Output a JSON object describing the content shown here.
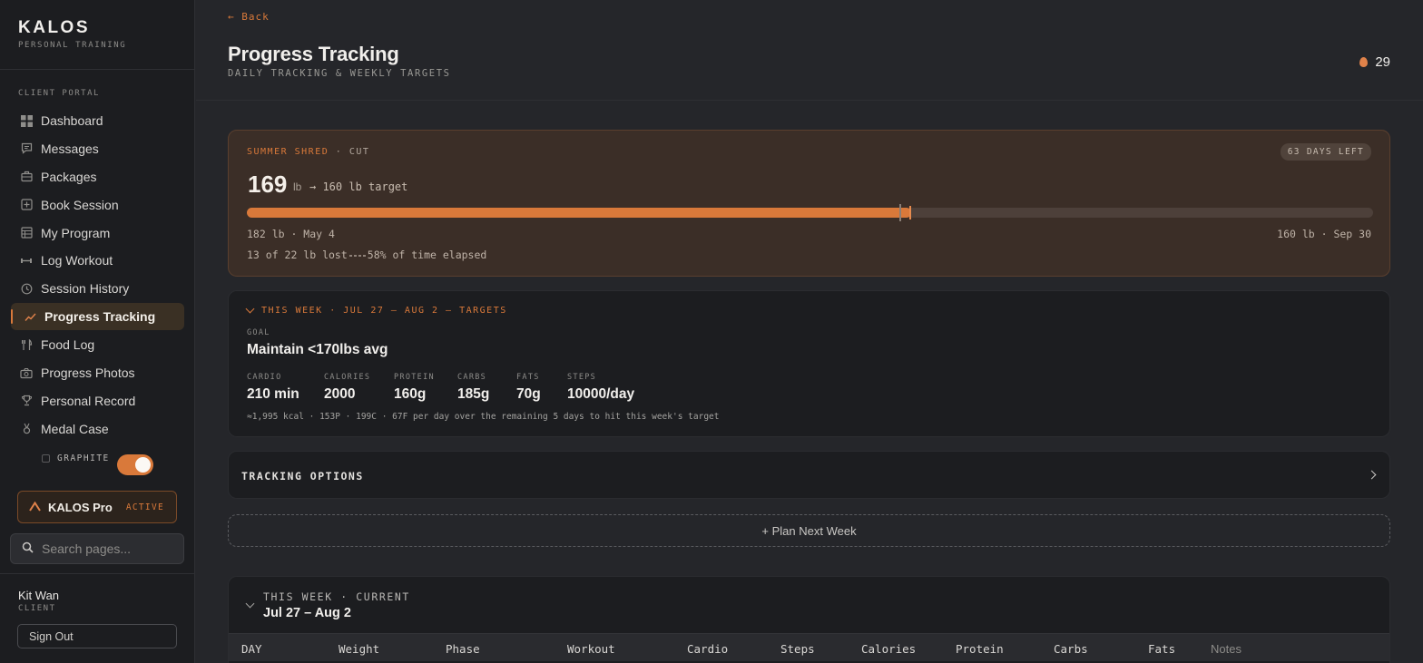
{
  "brand": {
    "name": "KALOS",
    "subtitle": "PERSONAL TRAINING"
  },
  "sidebar": {
    "section_label": "CLIENT PORTAL",
    "items": [
      {
        "label": "Dashboard",
        "icon": "grid-icon"
      },
      {
        "label": "Messages",
        "icon": "chat-icon"
      },
      {
        "label": "Packages",
        "icon": "briefcase-icon"
      },
      {
        "label": "Book Session",
        "icon": "plus-square-icon"
      },
      {
        "label": "My Program",
        "icon": "table-icon"
      },
      {
        "label": "Log Workout",
        "icon": "dumbbell-icon"
      },
      {
        "label": "Session History",
        "icon": "clock-icon"
      },
      {
        "label": "Progress Tracking",
        "icon": "trend-icon",
        "active": true
      },
      {
        "label": "Food Log",
        "icon": "utensils-icon"
      },
      {
        "label": "Progress Photos",
        "icon": "camera-icon"
      },
      {
        "label": "Personal Record",
        "icon": "trophy-icon"
      },
      {
        "label": "Medal Case",
        "icon": "medal-icon"
      }
    ],
    "theme_label": "GRAPHITE",
    "theme_on": true,
    "pro": {
      "name": "KALOS Pro",
      "status": "ACTIVE"
    },
    "search_placeholder": "Search pages...",
    "user": {
      "name": "Kit Wan",
      "role": "CLIENT"
    },
    "signout_label": "Sign Out"
  },
  "header": {
    "back_label": "← Back",
    "title": "Progress Tracking",
    "subtitle": "DAILY TRACKING & WEEKLY TARGETS",
    "streak": "29"
  },
  "goal": {
    "name": "SUMMER SHRED",
    "phase": "· CUT",
    "days_left": "63 DAYS LEFT",
    "current_weight": "169",
    "unit": "lb",
    "target_text": "→ 160 lb target",
    "progress_lost_fraction": 0.59,
    "time_elapsed_fraction": 0.58,
    "start_label": "182 lb · May 4",
    "end_label": "160 lb · Sep 30",
    "lost_label": "13 of 22 lb lost",
    "elapsed_label": "58% of time elapsed"
  },
  "week_targets": {
    "heading": "THIS WEEK · JUL 27 – AUG 2 — TARGETS",
    "goal_label": "GOAL",
    "goal_value": "Maintain <170lbs avg",
    "metrics": [
      {
        "label": "CARDIO",
        "value": "210 min"
      },
      {
        "label": "CALORIES",
        "value": "2000"
      },
      {
        "label": "PROTEIN",
        "value": "160g"
      },
      {
        "label": "CARBS",
        "value": "185g"
      },
      {
        "label": "FATS",
        "value": "70g"
      },
      {
        "label": "STEPS",
        "value": "10000/day"
      }
    ],
    "note": "≈1,995 kcal · 153P · 199C · 67F per day over the remaining 5 days to hit this week's target"
  },
  "tracking_options": {
    "label": "TRACKING OPTIONS"
  },
  "plan_next_week": {
    "label": "+ Plan Next Week"
  },
  "current_week": {
    "heading": "THIS WEEK · CURRENT",
    "range": "Jul 27 – Aug 2",
    "columns": [
      "DAY",
      "Weight",
      "Phase",
      "Workout",
      "Cardio",
      "Steps",
      "Calories",
      "Protein",
      "Carbs",
      "Fats",
      "Notes"
    ]
  }
}
